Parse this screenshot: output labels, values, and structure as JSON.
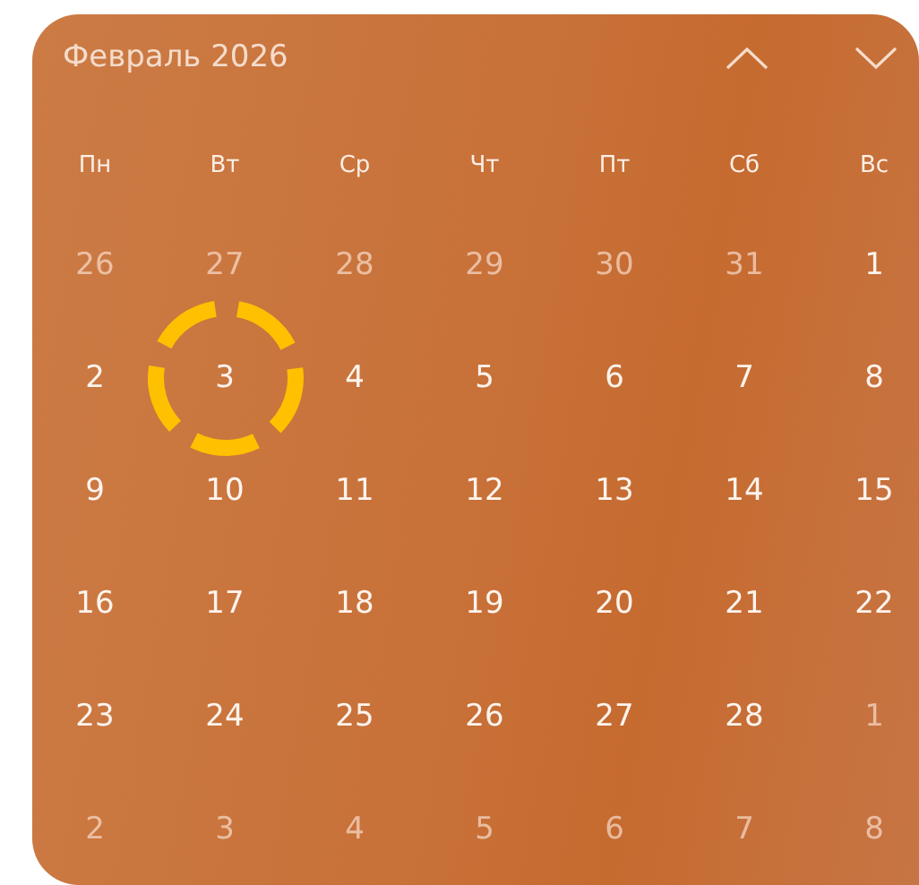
{
  "calendar": {
    "title": "Февраль 2026",
    "weekdays": [
      "Пн",
      "Вт",
      "Ср",
      "Чт",
      "Пт",
      "Сб",
      "Вс"
    ],
    "days": [
      {
        "label": "26",
        "other_month": true,
        "circled": false
      },
      {
        "label": "27",
        "other_month": true,
        "circled": false
      },
      {
        "label": "28",
        "other_month": true,
        "circled": false
      },
      {
        "label": "29",
        "other_month": true,
        "circled": false
      },
      {
        "label": "30",
        "other_month": true,
        "circled": false
      },
      {
        "label": "31",
        "other_month": true,
        "circled": false
      },
      {
        "label": "1",
        "other_month": false,
        "circled": false
      },
      {
        "label": "2",
        "other_month": false,
        "circled": false
      },
      {
        "label": "3",
        "other_month": false,
        "circled": true
      },
      {
        "label": "4",
        "other_month": false,
        "circled": false
      },
      {
        "label": "5",
        "other_month": false,
        "circled": false
      },
      {
        "label": "6",
        "other_month": false,
        "circled": false
      },
      {
        "label": "7",
        "other_month": false,
        "circled": false
      },
      {
        "label": "8",
        "other_month": false,
        "circled": false
      },
      {
        "label": "9",
        "other_month": false,
        "circled": false
      },
      {
        "label": "10",
        "other_month": false,
        "circled": false
      },
      {
        "label": "11",
        "other_month": false,
        "circled": false
      },
      {
        "label": "12",
        "other_month": false,
        "circled": false
      },
      {
        "label": "13",
        "other_month": false,
        "circled": false
      },
      {
        "label": "14",
        "other_month": false,
        "circled": false
      },
      {
        "label": "15",
        "other_month": false,
        "circled": false
      },
      {
        "label": "16",
        "other_month": false,
        "circled": false
      },
      {
        "label": "17",
        "other_month": false,
        "circled": false
      },
      {
        "label": "18",
        "other_month": false,
        "circled": false
      },
      {
        "label": "19",
        "other_month": false,
        "circled": false
      },
      {
        "label": "20",
        "other_month": false,
        "circled": false
      },
      {
        "label": "21",
        "other_month": false,
        "circled": false
      },
      {
        "label": "22",
        "other_month": false,
        "circled": false
      },
      {
        "label": "23",
        "other_month": false,
        "circled": false
      },
      {
        "label": "24",
        "other_month": false,
        "circled": false
      },
      {
        "label": "25",
        "other_month": false,
        "circled": false
      },
      {
        "label": "26",
        "other_month": false,
        "circled": false
      },
      {
        "label": "27",
        "other_month": false,
        "circled": false
      },
      {
        "label": "28",
        "other_month": false,
        "circled": false
      },
      {
        "label": "1",
        "other_month": true,
        "circled": false
      },
      {
        "label": "2",
        "other_month": true,
        "circled": false
      },
      {
        "label": "3",
        "other_month": true,
        "circled": false
      },
      {
        "label": "4",
        "other_month": true,
        "circled": false
      },
      {
        "label": "5",
        "other_month": true,
        "circled": false
      },
      {
        "label": "6",
        "other_month": true,
        "circled": false
      },
      {
        "label": "7",
        "other_month": true,
        "circled": false
      },
      {
        "label": "8",
        "other_month": true,
        "circled": false
      }
    ]
  }
}
